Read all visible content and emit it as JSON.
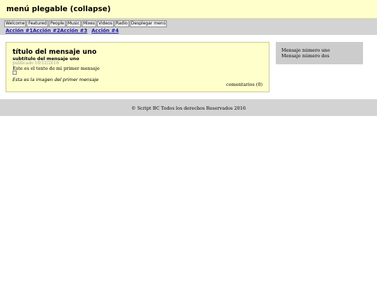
{
  "header": {
    "title": "menú plegable (collapse)"
  },
  "nav": {
    "buttons": [
      "Welcome",
      "Featured",
      "People",
      "Music",
      "Mixes",
      "Videos",
      "Radio",
      "Desplegar menú"
    ],
    "actions": [
      "Acción #1",
      "Acción #2",
      "Acción #3",
      "Acción #4"
    ]
  },
  "post": {
    "title": "título del mensaje uno",
    "subtitle": "subtítulo del mensaje uno",
    "date": "publicado 10/12/2016",
    "text": "Este es el texto de mi primer mensaje",
    "image_caption": "Esta es la imagen del primer mensaje",
    "comments": "comentarios (0)"
  },
  "sidebar": {
    "items": [
      "Mensaje número uno",
      "Mensaje número dos"
    ]
  },
  "footer": {
    "text": "© Script BC Todos los derechos Reservados 2016"
  },
  "colors": {
    "header_bg": "#ffffcc",
    "nav_bg": "#d3d3d3",
    "link": "#1a1aa8",
    "post_bg": "#ffffcc",
    "sidebar_bg": "#cccccc"
  }
}
